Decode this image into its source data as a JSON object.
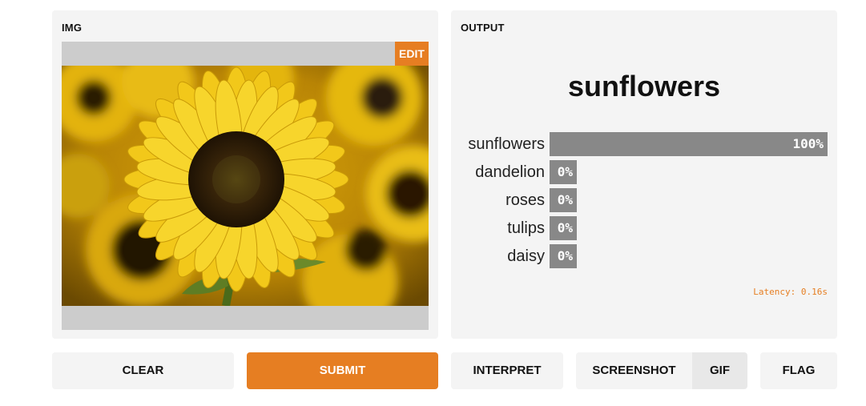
{
  "input": {
    "label": "IMG",
    "edit_label": "EDIT"
  },
  "output": {
    "label": "OUTPUT",
    "predicted_class": "sunflowers",
    "confidences": [
      {
        "label": "sunflowers",
        "value": "100%",
        "fraction": 1.0
      },
      {
        "label": "dandelion",
        "value": "0%",
        "fraction": 0.0
      },
      {
        "label": "roses",
        "value": "0%",
        "fraction": 0.0
      },
      {
        "label": "tulips",
        "value": "0%",
        "fraction": 0.0
      },
      {
        "label": "daisy",
        "value": "0%",
        "fraction": 0.0
      }
    ],
    "latency": "Latency: 0.16s"
  },
  "buttons": {
    "clear": "CLEAR",
    "submit": "SUBMIT",
    "interpret": "INTERPRET",
    "screenshot": "SCREENSHOT",
    "gif": "GIF",
    "flag": "FLAG"
  },
  "colors": {
    "accent": "#e67e22",
    "bar": "#888888",
    "panel": "#f4f4f4"
  }
}
